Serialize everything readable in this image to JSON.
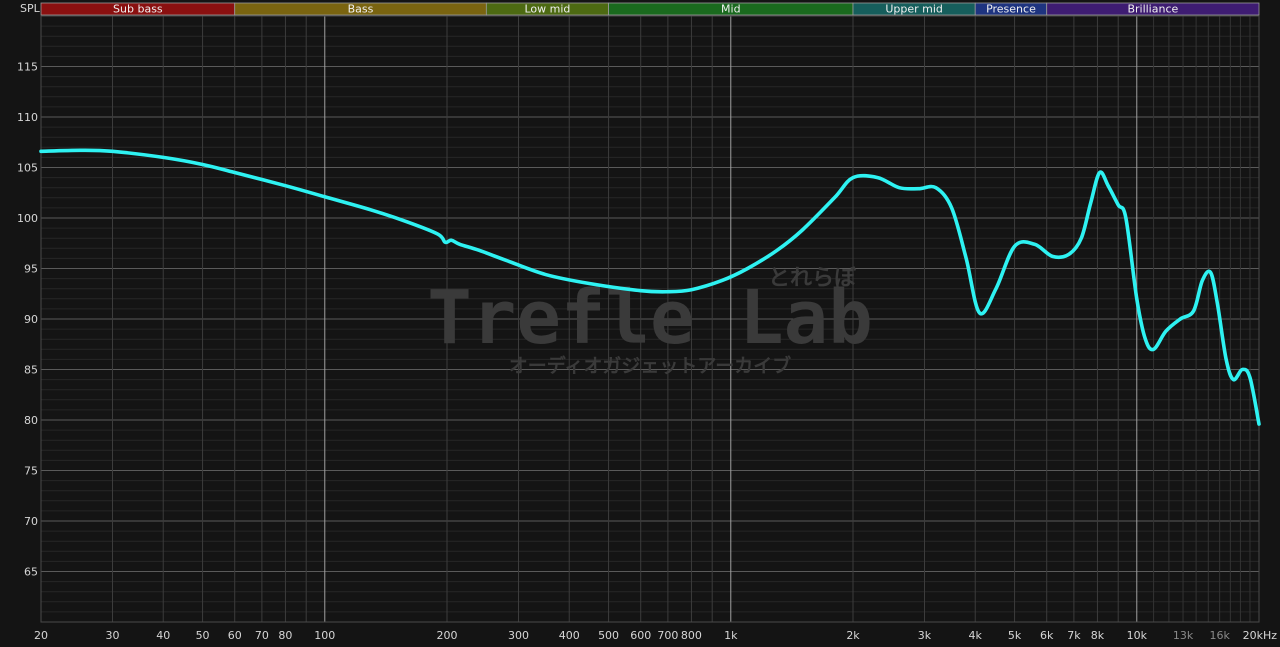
{
  "chart_data": {
    "type": "line",
    "title": "",
    "ylabel": "SPL",
    "xlabel": "",
    "x_scale": "log",
    "xlim": [
      20,
      20000
    ],
    "ylim": [
      60,
      120
    ],
    "grid": true,
    "x_tick_labels": [
      {
        "f": 20,
        "label": "20"
      },
      {
        "f": 30,
        "label": "30"
      },
      {
        "f": 40,
        "label": "40"
      },
      {
        "f": 50,
        "label": "50"
      },
      {
        "f": 60,
        "label": "60"
      },
      {
        "f": 70,
        "label": "70"
      },
      {
        "f": 80,
        "label": "80"
      },
      {
        "f": 100,
        "label": "100"
      },
      {
        "f": 200,
        "label": "200"
      },
      {
        "f": 300,
        "label": "300"
      },
      {
        "f": 400,
        "label": "400"
      },
      {
        "f": 500,
        "label": "500"
      },
      {
        "f": 600,
        "label": "600"
      },
      {
        "f": 700,
        "label": "700"
      },
      {
        "f": 800,
        "label": "800"
      },
      {
        "f": 1000,
        "label": "1k"
      },
      {
        "f": 2000,
        "label": "2k"
      },
      {
        "f": 3000,
        "label": "3k"
      },
      {
        "f": 4000,
        "label": "4k"
      },
      {
        "f": 5000,
        "label": "5k"
      },
      {
        "f": 6000,
        "label": "6k"
      },
      {
        "f": 7000,
        "label": "7k"
      },
      {
        "f": 8000,
        "label": "8k"
      },
      {
        "f": 10000,
        "label": "10k"
      },
      {
        "f": 13000,
        "label": "13k",
        "dim": true
      },
      {
        "f": 16000,
        "label": "16k",
        "dim": true
      },
      {
        "f": 20000,
        "label": "20kHz"
      }
    ],
    "y_ticks": [
      65,
      70,
      75,
      80,
      85,
      90,
      95,
      100,
      105,
      110,
      115
    ],
    "major_x_lines": [
      100,
      1000,
      10000
    ],
    "bands": [
      {
        "label": "Sub bass",
        "from": 20,
        "to": 60,
        "color": "#8a1010"
      },
      {
        "label": "Bass",
        "from": 60,
        "to": 250,
        "color": "#7a6410"
      },
      {
        "label": "Low mid",
        "from": 250,
        "to": 500,
        "color": "#4d6a12"
      },
      {
        "label": "Mid",
        "from": 500,
        "to": 2000,
        "color": "#1a6a1e"
      },
      {
        "label": "Upper mid",
        "from": 2000,
        "to": 4000,
        "color": "#165e5c"
      },
      {
        "label": "Presence",
        "from": 4000,
        "to": 6000,
        "color": "#1e3480"
      },
      {
        "label": "Brilliance",
        "from": 6000,
        "to": 20000,
        "color": "#3e1c72"
      }
    ],
    "series": [
      {
        "color": "#2ef2f2",
        "x": [
          20,
          25,
          30,
          40,
          50,
          60,
          80,
          100,
          130,
          160,
          190,
          198,
          205,
          215,
          240,
          280,
          350,
          450,
          600,
          700,
          800,
          950,
          1100,
          1300,
          1500,
          1800,
          2000,
          2300,
          2600,
          2900,
          3200,
          3500,
          3800,
          4100,
          4500,
          5000,
          5600,
          6200,
          6800,
          7300,
          7700,
          8100,
          8500,
          9000,
          9400,
          10000,
          10500,
          11000,
          11800,
          12800,
          13800,
          14500,
          15200,
          15800,
          16600,
          17300,
          18200,
          19000,
          20000
        ],
        "y": [
          106.6,
          106.7,
          106.6,
          106.0,
          105.3,
          104.5,
          103.2,
          102.1,
          100.8,
          99.6,
          98.4,
          97.6,
          97.8,
          97.4,
          96.8,
          95.8,
          94.4,
          93.5,
          92.8,
          92.7,
          92.9,
          93.8,
          95.0,
          96.8,
          98.8,
          102.0,
          104.0,
          104.0,
          103.0,
          102.9,
          103.0,
          101.0,
          96.0,
          90.6,
          93.0,
          97.2,
          97.4,
          96.2,
          96.4,
          98.0,
          101.5,
          104.5,
          103.2,
          101.3,
          100.0,
          92.0,
          88.0,
          87.0,
          88.8,
          90.0,
          90.8,
          93.8,
          94.6,
          91.5,
          86.0,
          84.0,
          85.0,
          84.2,
          79.6
        ]
      }
    ]
  },
  "watermark": {
    "title": "Trefle Lab",
    "tag": "とれらぼ",
    "subtitle": "オーディオガジェットアーカイブ"
  }
}
